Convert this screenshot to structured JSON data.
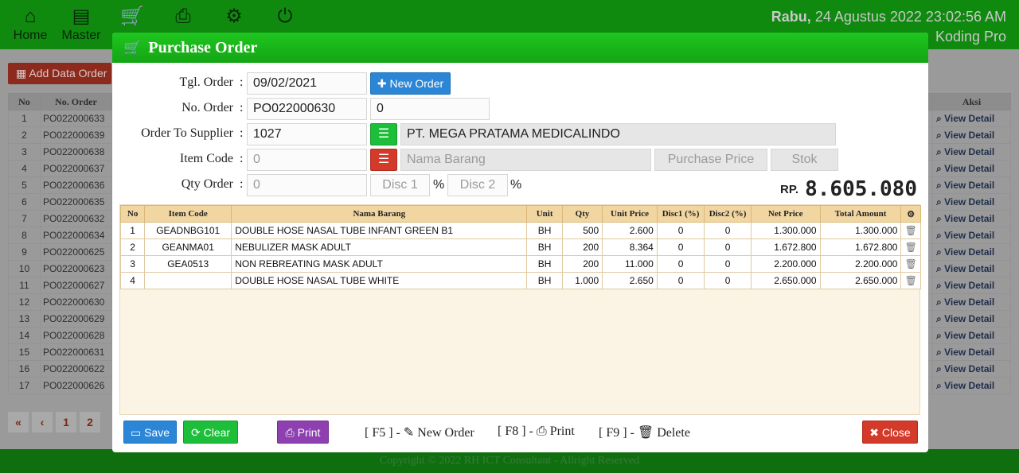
{
  "topbar": {
    "nav": [
      {
        "label": "Home",
        "icon": "home-icon",
        "glyph": "⌂"
      },
      {
        "label": "Master",
        "icon": "book-icon",
        "glyph": "▤"
      },
      {
        "label": "",
        "icon": "cart-icon",
        "glyph": "🛒"
      },
      {
        "label": "",
        "icon": "print-icon",
        "glyph": "⎙"
      },
      {
        "label": "",
        "icon": "gear-icon",
        "glyph": "⚙"
      },
      {
        "label": "",
        "icon": "power-icon",
        "glyph": "⏻"
      }
    ],
    "date_day": "Rabu,",
    "date_rest": "24 Agustus 2022 23:02:56 AM",
    "user": "Koding Pro"
  },
  "background": {
    "add_button": "Add Data Order",
    "columns": {
      "no": "No",
      "order": "No. Order",
      "aksi": "Aksi"
    },
    "rows": [
      {
        "no": "1",
        "order": "PO022000633"
      },
      {
        "no": "2",
        "order": "PO022000639"
      },
      {
        "no": "3",
        "order": "PO022000638"
      },
      {
        "no": "4",
        "order": "PO022000637"
      },
      {
        "no": "5",
        "order": "PO022000636"
      },
      {
        "no": "6",
        "order": "PO022000635"
      },
      {
        "no": "7",
        "order": "PO022000632"
      },
      {
        "no": "8",
        "order": "PO022000634"
      },
      {
        "no": "9",
        "order": "PO022000625"
      },
      {
        "no": "10",
        "order": "PO022000623"
      },
      {
        "no": "11",
        "order": "PO022000627"
      },
      {
        "no": "12",
        "order": "PO022000630"
      },
      {
        "no": "13",
        "order": "PO022000629"
      },
      {
        "no": "14",
        "order": "PO022000628"
      },
      {
        "no": "15",
        "order": "PO022000631"
      },
      {
        "no": "16",
        "order": "PO022000622"
      },
      {
        "no": "17",
        "order": "PO022000626"
      }
    ],
    "view_detail": "View Detail",
    "pager": [
      "«",
      "‹",
      "1",
      "2"
    ],
    "footer": "Copyright © 2022 RH ICT Consultant - Allright Reserved"
  },
  "modal": {
    "title": "Purchase Order",
    "labels": {
      "tgl_order": "Tgl. Order",
      "no_order": "No. Order",
      "supplier": "Order To Supplier",
      "item_code": "Item Code",
      "qty_order": "Qty Order"
    },
    "fields": {
      "tgl_order": "09/02/2021",
      "no_order": "PO022000630",
      "no_order_extra": "0",
      "supplier_code": "1027",
      "supplier_name": "PT. MEGA PRATAMA MEDICALINDO",
      "item_code_placeholder": "0",
      "nama_barang_placeholder": "Nama Barang",
      "purchase_price_placeholder": "Purchase Price",
      "stok_placeholder": "Stok",
      "qty_placeholder": "0",
      "disc1_placeholder": "Disc 1",
      "disc2_placeholder": "Disc 2",
      "pct": "%"
    },
    "new_order_button": "New Order",
    "total_prefix": "RP.",
    "total_amount": "8.605.080",
    "table": {
      "headers": [
        "No",
        "Item Code",
        "Nama Barang",
        "Unit",
        "Qty",
        "Unit Price",
        "Disc1 (%)",
        "Disc2 (%)",
        "Net Price",
        "Total Amount"
      ],
      "rows": [
        {
          "no": "1",
          "code": "GEADNBG101",
          "name": "DOUBLE HOSE NASAL TUBE INFANT GREEN B1",
          "unit": "BH",
          "qty": "500",
          "price": "2.600",
          "d1": "0",
          "d2": "0",
          "net": "1.300.000",
          "total": "1.300.000"
        },
        {
          "no": "2",
          "code": "GEANMA01",
          "name": "NEBULIZER MASK ADULT",
          "unit": "BH",
          "qty": "200",
          "price": "8.364",
          "d1": "0",
          "d2": "0",
          "net": "1.672.800",
          "total": "1.672.800"
        },
        {
          "no": "3",
          "code": "GEA0513",
          "name": "NON REBREATING MASK ADULT",
          "unit": "BH",
          "qty": "200",
          "price": "11.000",
          "d1": "0",
          "d2": "0",
          "net": "2.200.000",
          "total": "2.200.000"
        },
        {
          "no": "4",
          "code": "",
          "name": "DOUBLE HOSE NASAL TUBE WHITE",
          "unit": "BH",
          "qty": "1.000",
          "price": "2.650",
          "d1": "0",
          "d2": "0",
          "net": "2.650.000",
          "total": "2.650.000"
        }
      ]
    },
    "buttons": {
      "save": "Save",
      "clear": "Clear",
      "print": "Print",
      "close": "Close"
    },
    "shortcuts": {
      "f5_key": "[ F5 ] -",
      "f5_label": "New Order",
      "f8_key": "[ F8 ] -",
      "f8_label": "Print",
      "f9_key": "[ F9 ] -",
      "f9_label": "Delete"
    }
  }
}
